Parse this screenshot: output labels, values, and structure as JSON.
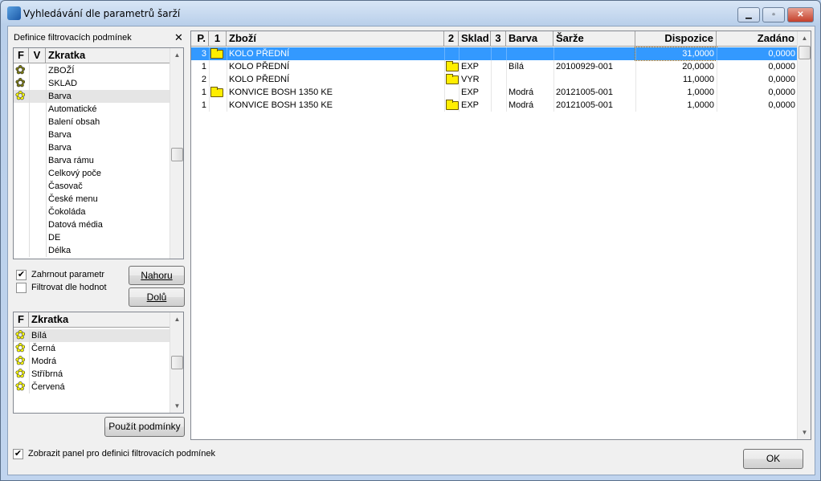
{
  "window": {
    "title": "Vyhledávání dle parametrů šarží",
    "buttons": [
      "minimize",
      "maximize",
      "close"
    ]
  },
  "filter_panel": {
    "title": "Definice filtrovacích podmínek",
    "close_icon": "close-icon",
    "param_grid": {
      "headers": [
        "F",
        "V",
        "Zkratka"
      ],
      "rows": [
        {
          "f": "star-dark",
          "name": "ZBOŽÍ"
        },
        {
          "f": "star-dark",
          "name": "SKLAD"
        },
        {
          "f": "star-yellow",
          "name": "Barva",
          "selected": true
        },
        {
          "f": "",
          "name": "Automatické"
        },
        {
          "f": "",
          "name": "Balení obsah"
        },
        {
          "f": "",
          "name": "Barva"
        },
        {
          "f": "",
          "name": "Barva"
        },
        {
          "f": "",
          "name": "Barva rámu"
        },
        {
          "f": "",
          "name": "Celkový poče"
        },
        {
          "f": "",
          "name": "Časovač"
        },
        {
          "f": "",
          "name": "České menu"
        },
        {
          "f": "",
          "name": "Čokoláda"
        },
        {
          "f": "",
          "name": "Datová média"
        },
        {
          "f": "",
          "name": "DE"
        },
        {
          "f": "",
          "name": "Délka"
        }
      ]
    },
    "include_param": {
      "label": "Zahrnout parametr",
      "checked": true
    },
    "filter_by_values": {
      "label": "Filtrovat dle hodnot",
      "checked": false
    },
    "up_button": "Nahoru",
    "down_button": "Dolů",
    "value_grid": {
      "headers": [
        "F",
        "Zkratka"
      ],
      "rows": [
        "Bílá",
        "Černá",
        "Modrá",
        "Stříbrná",
        "Červená"
      ]
    },
    "apply_button": "Použít podmínky"
  },
  "results": {
    "headers": [
      "P.",
      "1",
      "Zboží",
      "2",
      "Sklad",
      "3",
      "Barva",
      "Šarže",
      "Dispozice",
      "Zadáno"
    ],
    "rows": [
      {
        "p": "3",
        "f1": true,
        "zbozi": "KOLO PŘEDNÍ",
        "f2": false,
        "sklad": "",
        "barva": "",
        "sarze": "",
        "dispozice": "31,0000",
        "zadano": "0,0000",
        "selected": true
      },
      {
        "p": "1",
        "f1": false,
        "zbozi": "KOLO PŘEDNÍ",
        "f2": true,
        "sklad": "EXP",
        "barva": "Bílá",
        "sarze": "20100929-001",
        "dispozice": "20,0000",
        "zadano": "0,0000"
      },
      {
        "p": "2",
        "f1": false,
        "zbozi": "KOLO PŘEDNÍ",
        "f2": true,
        "sklad": "VYR",
        "barva": "",
        "sarze": "",
        "dispozice": "11,0000",
        "zadano": "0,0000"
      },
      {
        "p": "1",
        "f1": true,
        "zbozi": "KONVICE BOSH 1350 KE",
        "f2": false,
        "sklad": "EXP",
        "barva": "Modrá",
        "sarze": "20121005-001",
        "dispozice": "1,0000",
        "zadano": "0,0000"
      },
      {
        "p": "1",
        "f1": false,
        "zbozi": "KONVICE BOSH 1350 KE",
        "f2": true,
        "sklad": "EXP",
        "barva": "Modrá",
        "sarze": "20121005-001",
        "dispozice": "1,0000",
        "zadano": "0,0000"
      }
    ]
  },
  "footer": {
    "show_panel": {
      "label": "Zobrazit panel pro definici filtrovacích podmínek",
      "checked": true
    },
    "ok_button": "OK"
  },
  "colors": {
    "selection": "#3399ff",
    "star_dark": "#7a7a10",
    "star_yellow": "#ffff00"
  }
}
